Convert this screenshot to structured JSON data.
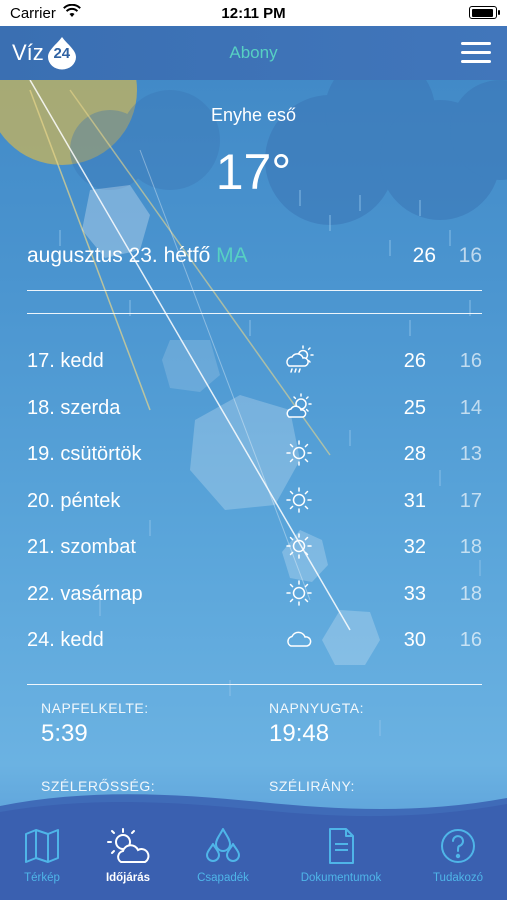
{
  "status_bar": {
    "carrier": "Carrier",
    "time": "12:11 PM"
  },
  "header": {
    "logo_text": "Víz",
    "logo_number": "24",
    "location": "Abony"
  },
  "current": {
    "condition": "Enyhe eső",
    "temperature": "17°"
  },
  "today": {
    "date": "augusztus 23. hétfő",
    "label": "MA",
    "high": "26",
    "low": "16"
  },
  "forecast": [
    {
      "day": "17. kedd",
      "icon": "sun-cloud-rain-icon",
      "high": "26",
      "low": "16"
    },
    {
      "day": "18. szerda",
      "icon": "sun-cloud-icon",
      "high": "25",
      "low": "14"
    },
    {
      "day": "19. csütörtök",
      "icon": "sun-icon",
      "high": "28",
      "low": "13"
    },
    {
      "day": "20. péntek",
      "icon": "sun-icon",
      "high": "31",
      "low": "17"
    },
    {
      "day": "21. szombat",
      "icon": "sun-icon",
      "high": "32",
      "low": "18"
    },
    {
      "day": "22. vasárnap",
      "icon": "sun-icon",
      "high": "33",
      "low": "18"
    },
    {
      "day": "24. kedd",
      "icon": "cloud-icon",
      "high": "30",
      "low": "16"
    }
  ],
  "info": {
    "sunrise_label": "NAPFELKELTE:",
    "sunrise_value": "5:39",
    "sunset_label": "NAPNYUGTA:",
    "sunset_value": "19:48",
    "wind_strength_label": "SZÉLERŐSSÉG:",
    "wind_direction_label": "SZÉLIRÁNY:"
  },
  "tabs": [
    {
      "label": "Térkép",
      "icon": "map-icon",
      "active": false
    },
    {
      "label": "Időjárás",
      "icon": "weather-icon",
      "active": true
    },
    {
      "label": "Csapadék",
      "icon": "drops-icon",
      "active": false
    },
    {
      "label": "Dokumentumok",
      "icon": "document-icon",
      "active": false
    },
    {
      "label": "Tudakozó",
      "icon": "question-icon",
      "active": false
    }
  ],
  "colors": {
    "accent_teal": "#57d0c3",
    "tab_inactive": "#4fb5e8",
    "header": "#3a6fb2"
  }
}
